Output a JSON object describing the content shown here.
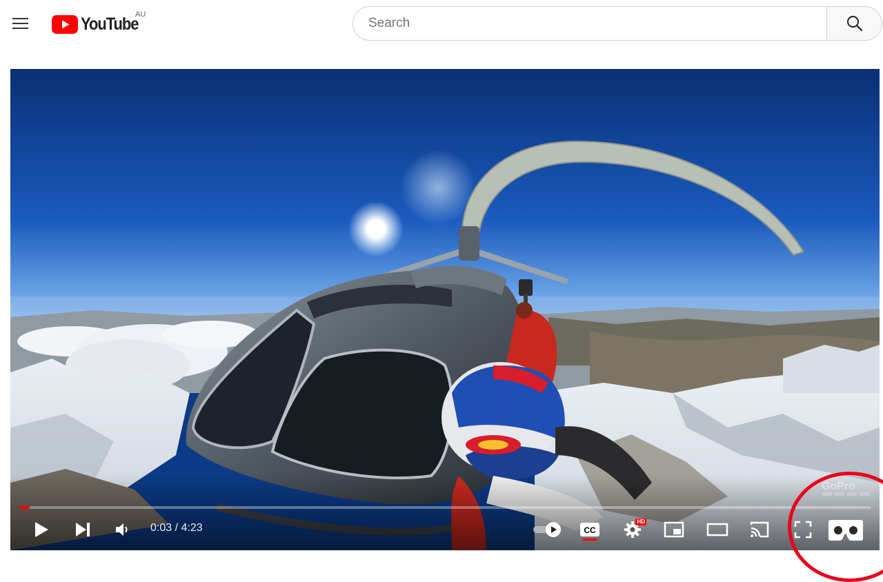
{
  "masthead": {
    "logo_text": "YouTube",
    "region_code": "AU",
    "search": {
      "placeholder": "Search",
      "value": ""
    }
  },
  "player": {
    "current_time": "0:03",
    "duration": "4:23",
    "time_separator": " / ",
    "progress_fraction": 0.012,
    "hd_badge": "HD",
    "watermark": "GoPro",
    "colors": {
      "progress": "#ff0000",
      "annotation_circle": "#e8001c"
    }
  }
}
